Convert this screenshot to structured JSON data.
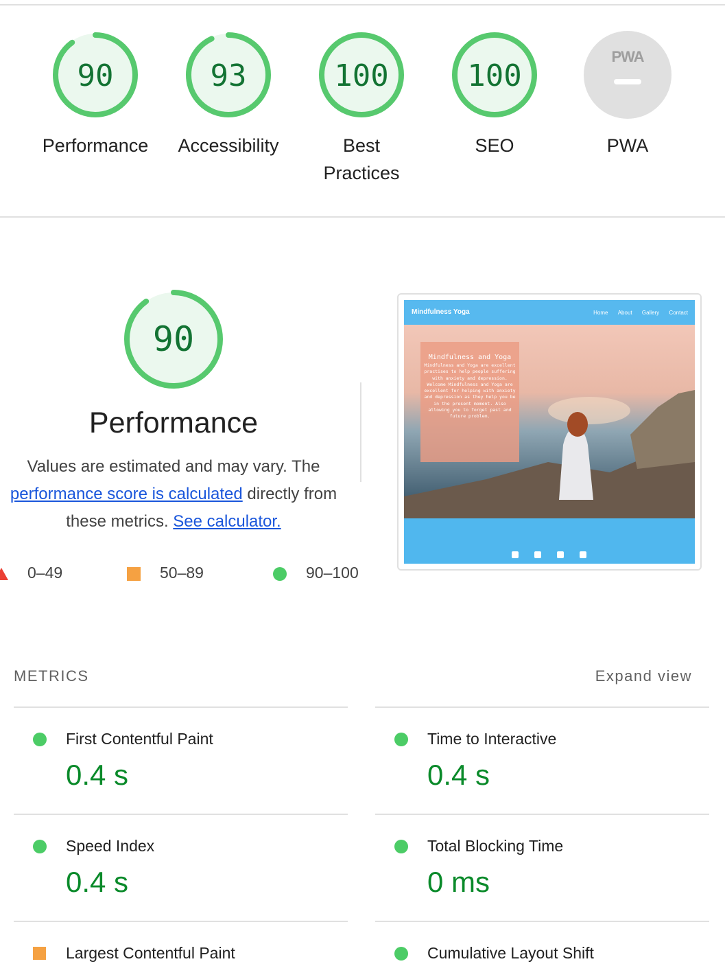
{
  "gauges": [
    {
      "label": "Performance",
      "score": "90",
      "value": 90,
      "color": "#0cce6b"
    },
    {
      "label": "Accessibility",
      "score": "93",
      "value": 93,
      "color": "#0cce6b"
    },
    {
      "label": "Best Practices",
      "score": "100",
      "value": 100,
      "color": "#0cce6b"
    },
    {
      "label": "SEO",
      "score": "100",
      "value": 100,
      "color": "#0cce6b"
    },
    {
      "label": "PWA",
      "badge": "PWA",
      "score": "–",
      "color": "#e0e0e0"
    }
  ],
  "performance": {
    "score": "90",
    "value": 90,
    "title": "Performance",
    "desc_before": "Values are estimated and may vary. The ",
    "desc_link": "performance score is calculated",
    "desc_mid": " directly from these metrics. ",
    "desc_link2": "See calculator."
  },
  "legend": [
    {
      "shape": "triangle",
      "label": "0–49",
      "color": "#eb4034"
    },
    {
      "shape": "square",
      "label": "50–89",
      "color": "#f5a142"
    },
    {
      "shape": "circle",
      "label": "90–100",
      "color": "#4ccc66"
    }
  ],
  "screenshot": {
    "brand": "Mindfulness Yoga",
    "nav": [
      "Home",
      "About",
      "Gallery",
      "Contact"
    ],
    "card_title": "Mindfulness and Yoga",
    "card_body": "Mindfulness and Yoga are excellent practises to help people suffering with anxiety and depression. Welcome Mindfulness and Yoga are excellent for helping with anxiety and depression as they help you be in the present moment. Also allowing you to forget past and future problem.",
    "social_icons": [
      "facebook-icon",
      "twitter-icon",
      "youtube-icon",
      "instagram-icon"
    ]
  },
  "metrics": {
    "heading": "METRICS",
    "expand": "Expand view",
    "items": [
      {
        "label": "First Contentful Paint",
        "value": "0.4 s",
        "status": "pass"
      },
      {
        "label": "Time to Interactive",
        "value": "0.4 s",
        "status": "pass"
      },
      {
        "label": "Speed Index",
        "value": "0.4 s",
        "status": "pass"
      },
      {
        "label": "Total Blocking Time",
        "value": "0 ms",
        "status": "pass"
      },
      {
        "label": "Largest Contentful Paint",
        "value": "",
        "status": "average"
      },
      {
        "label": "Cumulative Layout Shift",
        "value": "",
        "status": "pass"
      }
    ]
  }
}
